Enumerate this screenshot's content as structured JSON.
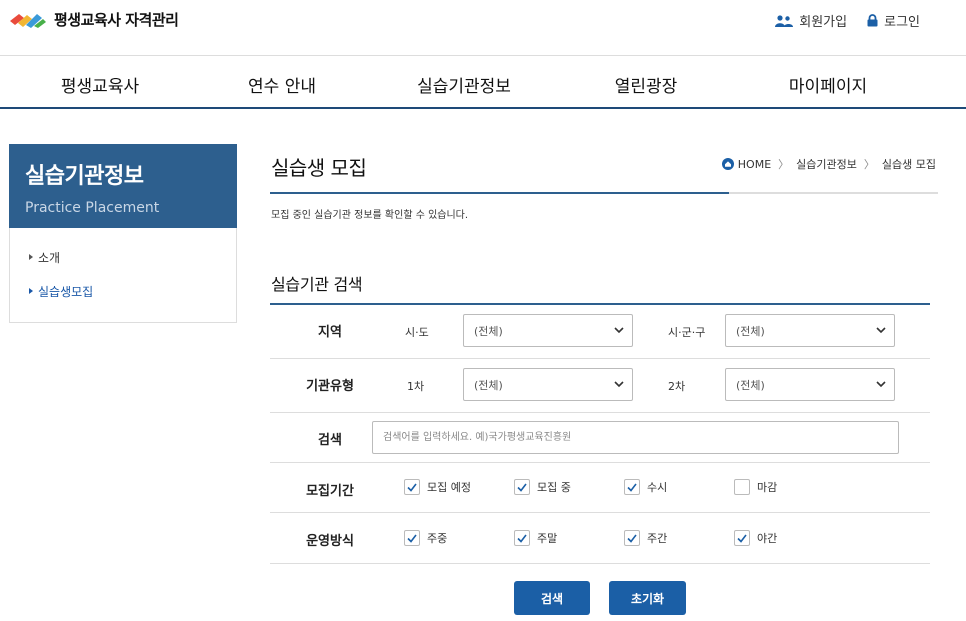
{
  "header": {
    "logo_text": "평생교육사 자격관리",
    "signup_label": "회원가입",
    "login_label": "로그인"
  },
  "nav": {
    "items": [
      "평생교육사",
      "연수 안내",
      "실습기관정보",
      "열린광장",
      "마이페이지"
    ]
  },
  "sidebar": {
    "title": "실습기관정보",
    "subtitle": "Practice Placement",
    "items": [
      {
        "label": "소개",
        "active": false
      },
      {
        "label": "실습생모집",
        "active": true
      }
    ]
  },
  "page": {
    "title": "실습생 모집",
    "breadcrumb": [
      "HOME",
      "실습기관정보",
      "실습생 모집"
    ],
    "description": "모집 중인 실습기관 정보를 확인할 수 있습니다."
  },
  "search_form": {
    "title": "실습기관 검색",
    "region": {
      "label": "지역",
      "sido_label": "시·도",
      "sido_value": "(전체)",
      "sigungu_label": "시·군·구",
      "sigungu_value": "(전체)"
    },
    "type": {
      "label": "기관유형",
      "first_label": "1차",
      "first_value": "(전체)",
      "second_label": "2차",
      "second_value": "(전체)"
    },
    "keyword": {
      "label": "검색",
      "placeholder": "검색어를 입력하세요. 예)국가평생교육진흥원",
      "value": ""
    },
    "period": {
      "label": "모집기간",
      "options": [
        {
          "label": "모집 예정",
          "checked": true
        },
        {
          "label": "모집 중",
          "checked": true
        },
        {
          "label": "수시",
          "checked": true
        },
        {
          "label": "마감",
          "checked": false
        }
      ]
    },
    "operation": {
      "label": "운영방식",
      "options": [
        {
          "label": "주중",
          "checked": true
        },
        {
          "label": "주말",
          "checked": true
        },
        {
          "label": "주간",
          "checked": true
        },
        {
          "label": "야간",
          "checked": true
        }
      ]
    },
    "search_button": "검색",
    "reset_button": "초기화"
  },
  "colors": {
    "primary": "#1b5fa6",
    "sidebar_head": "#2d5f8e",
    "nav_border": "#1e4a78"
  }
}
